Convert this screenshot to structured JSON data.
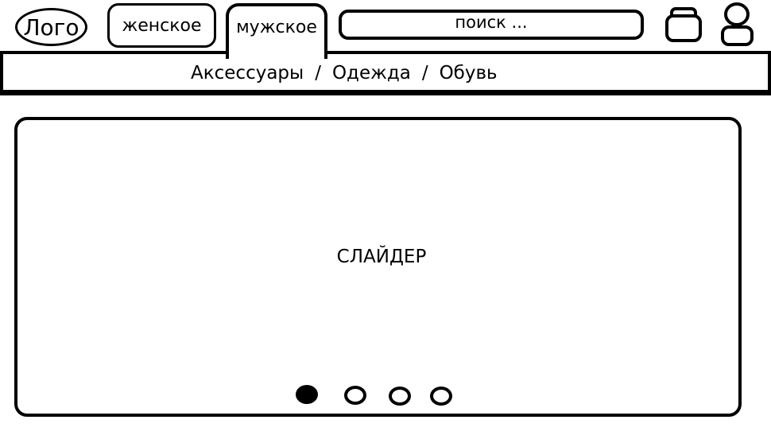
{
  "header": {
    "logo_label": "Лого",
    "tabs": [
      {
        "label": "женское",
        "active": false
      },
      {
        "label": "мужское",
        "active": true
      }
    ],
    "search": {
      "placeholder": "поиск ...",
      "value": ""
    },
    "icons": [
      "cart-icon",
      "user-icon"
    ]
  },
  "category_nav": {
    "items": [
      "Аксессуары",
      "Одежда",
      "Обувь"
    ],
    "separator": "/"
  },
  "slider": {
    "label": "СЛАЙДЕР",
    "dots": [
      {
        "active": true
      },
      {
        "active": false
      },
      {
        "active": false
      },
      {
        "active": false
      }
    ],
    "active_index": 0
  },
  "colors": {
    "line": "#000000",
    "background": "#ffffff"
  }
}
